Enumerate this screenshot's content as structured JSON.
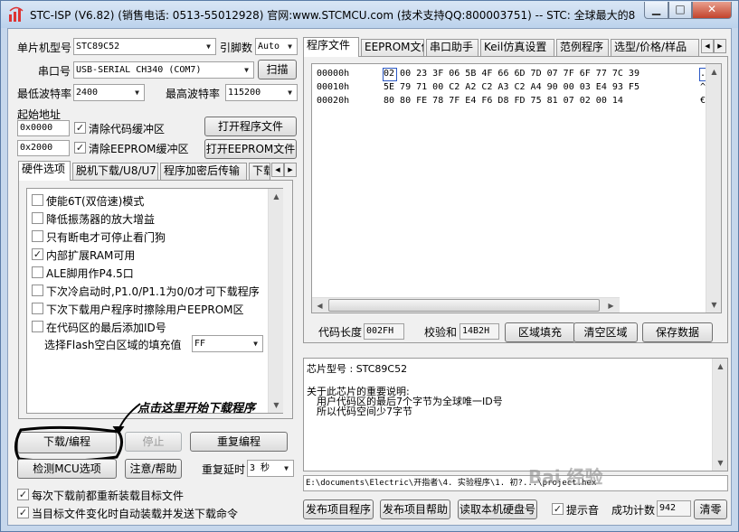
{
  "window": {
    "title": "STC-ISP (V6.82) (销售电话: 0513-55012928) 官网:www.STCMCU.com  (技术支持QQ:800003751)  -- STC: 全球最大的80..."
  },
  "left": {
    "mcu_type_label": "单片机型号",
    "mcu_type_value": "STC89C52",
    "pins_label": "引脚数",
    "pins_value": "Auto",
    "com_label": "串口号",
    "com_value": "USB-SERIAL CH340 (COM7)",
    "scan_button": "扫描",
    "min_baud_label": "最低波特率",
    "min_baud_value": "2400",
    "max_baud_label": "最高波特率",
    "max_baud_value": "115200",
    "start_addr_label": "起始地址",
    "addr_code": "0x0000",
    "clear_code_label": "清除代码缓冲区",
    "open_program_button": "打开程序文件",
    "addr_eeprom": "0x2000",
    "clear_eeprom_label": "清除EEPROM缓冲区",
    "open_eeprom_button": "打开EEPROM文件"
  },
  "options_tabs": [
    {
      "label": "硬件选项"
    },
    {
      "label": "脱机下载/U8/U7"
    },
    {
      "label": "程序加密后传输"
    },
    {
      "label": "下载"
    }
  ],
  "options": [
    {
      "label": "使能6T(双倍速)模式",
      "checked": false
    },
    {
      "label": "降低振荡器的放大增益",
      "checked": false
    },
    {
      "label": "只有断电才可停止看门狗",
      "checked": false
    },
    {
      "label": "内部扩展RAM可用",
      "checked": true
    },
    {
      "label": "ALE脚用作P4.5口",
      "checked": false
    },
    {
      "label": "下次冷启动时,P1.0/P1.1为0/0才可下载程序",
      "checked": false
    },
    {
      "label": "下次下载用户程序时擦除用户EEPROM区",
      "checked": false
    },
    {
      "label": "在代码区的最后添加ID号",
      "checked": false
    }
  ],
  "fill_label": "选择Flash空白区域的填充值",
  "fill_value": "FF",
  "actions": {
    "download_button": "下载/编程",
    "stop_button": "停止",
    "reprogram_button": "重复编程",
    "detect_button": "检测MCU选项",
    "help_button": "注意/帮助",
    "delay_label": "重复延时",
    "delay_value": "3 秒",
    "reload_label": "每次下载前都重新装载目标文件",
    "autoload_label": "当目标文件变化时自动装载并发送下载命令"
  },
  "annotation": "点击这里开始下载程序",
  "right_tabs": [
    {
      "label": "程序文件"
    },
    {
      "label": "EEPROM文件"
    },
    {
      "label": "串口助手"
    },
    {
      "label": "Keil仿真设置"
    },
    {
      "label": "范例程序"
    },
    {
      "label": "选型/价格/样品"
    }
  ],
  "hex_view": {
    "rows": [
      {
        "addr": "00000h",
        "bytes": "02 00 23 3F 06 5B 4F 66 6D 7D 07 7F 6F 77 7C 39",
        "ascii": ".."
      },
      {
        "addr": "00010h",
        "bytes": "5E 79 71 00 C2 A2 C2 A3 C2 A4 90 00 03 E4 93 F5",
        "ascii": "^y"
      },
      {
        "addr": "00020h",
        "bytes": "80 80 FE 78 7F E4 F6 D8 FD 75 81 07 02 00 14",
        "ascii": "€€"
      }
    ]
  },
  "code_bar": {
    "length_label": "代码长度",
    "length_value": "002FH",
    "checksum_label": "校验和",
    "checksum_value": "14B2H",
    "fill_area_button": "区域填充",
    "clear_area_button": "清空区域",
    "save_button": "保存数据"
  },
  "info": {
    "chip_line": "芯片型号 : STC89C52",
    "line1": "关于此芯片的重要说明:",
    "line2": "用户代码区的最后7个字节为全球唯一ID号",
    "line3": "所以代码空间少7字节"
  },
  "path": "E:\\documents\\Electric\\开指者\\4. 实验程序\\1. 初?...\\project.hex",
  "bottom": {
    "publish_button": "发布项目程序",
    "publish_help_button": "发布项目帮助",
    "read_disk_button": "读取本机硬盘号",
    "tip_label": "提示音",
    "success_label": "成功计数",
    "success_value": "942",
    "clear_button": "清零"
  },
  "watermark": "Bai 经验"
}
